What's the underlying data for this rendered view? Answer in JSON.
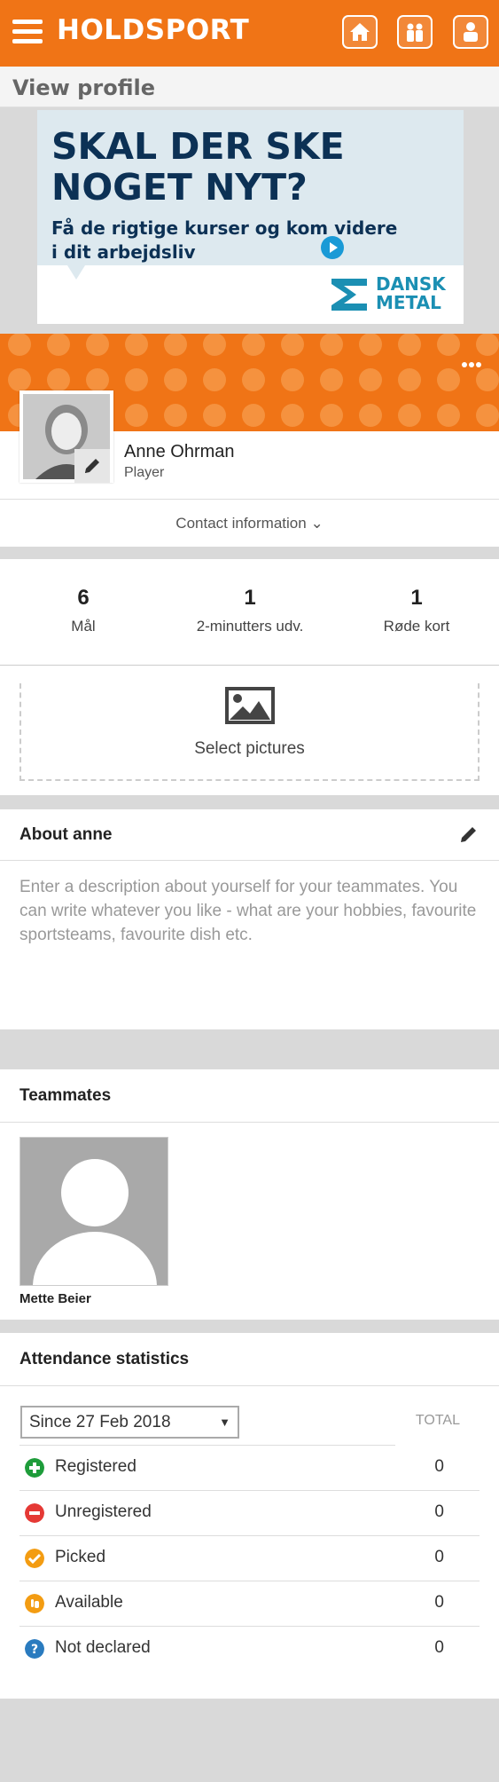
{
  "header": {
    "brand": "HOLDSPORT",
    "nav": [
      {
        "name": "home-icon"
      },
      {
        "name": "team-icon"
      },
      {
        "name": "profile-icon"
      }
    ]
  },
  "page": {
    "title": "View profile"
  },
  "ad": {
    "headline": "SKAL DER SKE NOGET NYT?",
    "subline": "Få de rigtige kurser og kom videre i dit arbejdsliv",
    "logo_line1": "DANSK",
    "logo_line2": "METAL"
  },
  "profile": {
    "name": "Anne Ohrman",
    "role": "Player",
    "contact_label": "Contact information",
    "contact_chevron": "⌄"
  },
  "stats": [
    {
      "value": "6",
      "label": "Mål"
    },
    {
      "value": "1",
      "label": "2-minutters udv."
    },
    {
      "value": "1",
      "label": "Røde kort"
    }
  ],
  "pictures": {
    "label": "Select pictures"
  },
  "about": {
    "title": "About anne",
    "placeholder": "Enter a description about yourself for your teammates. You can write whatever you like - what are your hobbies, favourite sportsteams, favourite dish etc."
  },
  "teammates": {
    "title": "Teammates",
    "items": [
      {
        "name": "Mette Beier"
      }
    ]
  },
  "attendance": {
    "title": "Attendance statistics",
    "period": "Since 27 Feb 2018",
    "period_arrow": "▼",
    "total_header": "TOTAL",
    "rows": [
      {
        "label": "Registered",
        "value": "0",
        "icon": "plus-circle-icon",
        "color": "#1e9c3a"
      },
      {
        "label": "Unregistered",
        "value": "0",
        "icon": "minus-circle-icon",
        "color": "#e53935"
      },
      {
        "label": "Picked",
        "value": "0",
        "icon": "check-circle-icon",
        "color": "#f39c12"
      },
      {
        "label": "Available",
        "value": "0",
        "icon": "hand-circle-icon",
        "color": "#f39c12"
      },
      {
        "label": "Not declared",
        "value": "0",
        "icon": "question-circle-icon",
        "color": "#2a7bbf"
      }
    ]
  },
  "colors": {
    "brand_orange": "#f07416",
    "ad_blue": "#0c3155",
    "logo_teal": "#1b8fb3"
  }
}
